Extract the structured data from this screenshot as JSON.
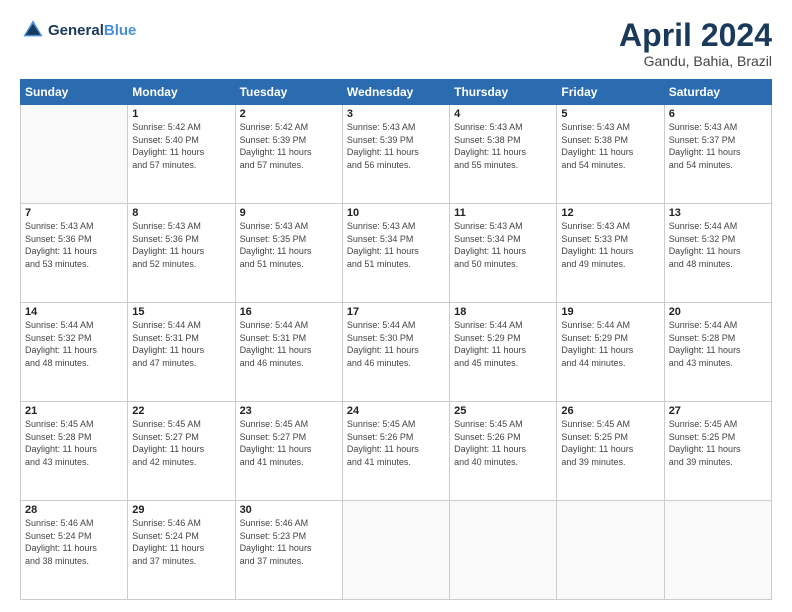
{
  "header": {
    "logo_line1": "General",
    "logo_line2": "Blue",
    "month": "April 2024",
    "location": "Gandu, Bahia, Brazil"
  },
  "weekdays": [
    "Sunday",
    "Monday",
    "Tuesday",
    "Wednesday",
    "Thursday",
    "Friday",
    "Saturday"
  ],
  "weeks": [
    [
      {
        "day": "",
        "info": ""
      },
      {
        "day": "1",
        "info": "Sunrise: 5:42 AM\nSunset: 5:40 PM\nDaylight: 11 hours\nand 57 minutes."
      },
      {
        "day": "2",
        "info": "Sunrise: 5:42 AM\nSunset: 5:39 PM\nDaylight: 11 hours\nand 57 minutes."
      },
      {
        "day": "3",
        "info": "Sunrise: 5:43 AM\nSunset: 5:39 PM\nDaylight: 11 hours\nand 56 minutes."
      },
      {
        "day": "4",
        "info": "Sunrise: 5:43 AM\nSunset: 5:38 PM\nDaylight: 11 hours\nand 55 minutes."
      },
      {
        "day": "5",
        "info": "Sunrise: 5:43 AM\nSunset: 5:38 PM\nDaylight: 11 hours\nand 54 minutes."
      },
      {
        "day": "6",
        "info": "Sunrise: 5:43 AM\nSunset: 5:37 PM\nDaylight: 11 hours\nand 54 minutes."
      }
    ],
    [
      {
        "day": "7",
        "info": "Sunrise: 5:43 AM\nSunset: 5:36 PM\nDaylight: 11 hours\nand 53 minutes."
      },
      {
        "day": "8",
        "info": "Sunrise: 5:43 AM\nSunset: 5:36 PM\nDaylight: 11 hours\nand 52 minutes."
      },
      {
        "day": "9",
        "info": "Sunrise: 5:43 AM\nSunset: 5:35 PM\nDaylight: 11 hours\nand 51 minutes."
      },
      {
        "day": "10",
        "info": "Sunrise: 5:43 AM\nSunset: 5:34 PM\nDaylight: 11 hours\nand 51 minutes."
      },
      {
        "day": "11",
        "info": "Sunrise: 5:43 AM\nSunset: 5:34 PM\nDaylight: 11 hours\nand 50 minutes."
      },
      {
        "day": "12",
        "info": "Sunrise: 5:43 AM\nSunset: 5:33 PM\nDaylight: 11 hours\nand 49 minutes."
      },
      {
        "day": "13",
        "info": "Sunrise: 5:44 AM\nSunset: 5:32 PM\nDaylight: 11 hours\nand 48 minutes."
      }
    ],
    [
      {
        "day": "14",
        "info": "Sunrise: 5:44 AM\nSunset: 5:32 PM\nDaylight: 11 hours\nand 48 minutes."
      },
      {
        "day": "15",
        "info": "Sunrise: 5:44 AM\nSunset: 5:31 PM\nDaylight: 11 hours\nand 47 minutes."
      },
      {
        "day": "16",
        "info": "Sunrise: 5:44 AM\nSunset: 5:31 PM\nDaylight: 11 hours\nand 46 minutes."
      },
      {
        "day": "17",
        "info": "Sunrise: 5:44 AM\nSunset: 5:30 PM\nDaylight: 11 hours\nand 46 minutes."
      },
      {
        "day": "18",
        "info": "Sunrise: 5:44 AM\nSunset: 5:29 PM\nDaylight: 11 hours\nand 45 minutes."
      },
      {
        "day": "19",
        "info": "Sunrise: 5:44 AM\nSunset: 5:29 PM\nDaylight: 11 hours\nand 44 minutes."
      },
      {
        "day": "20",
        "info": "Sunrise: 5:44 AM\nSunset: 5:28 PM\nDaylight: 11 hours\nand 43 minutes."
      }
    ],
    [
      {
        "day": "21",
        "info": "Sunrise: 5:45 AM\nSunset: 5:28 PM\nDaylight: 11 hours\nand 43 minutes."
      },
      {
        "day": "22",
        "info": "Sunrise: 5:45 AM\nSunset: 5:27 PM\nDaylight: 11 hours\nand 42 minutes."
      },
      {
        "day": "23",
        "info": "Sunrise: 5:45 AM\nSunset: 5:27 PM\nDaylight: 11 hours\nand 41 minutes."
      },
      {
        "day": "24",
        "info": "Sunrise: 5:45 AM\nSunset: 5:26 PM\nDaylight: 11 hours\nand 41 minutes."
      },
      {
        "day": "25",
        "info": "Sunrise: 5:45 AM\nSunset: 5:26 PM\nDaylight: 11 hours\nand 40 minutes."
      },
      {
        "day": "26",
        "info": "Sunrise: 5:45 AM\nSunset: 5:25 PM\nDaylight: 11 hours\nand 39 minutes."
      },
      {
        "day": "27",
        "info": "Sunrise: 5:45 AM\nSunset: 5:25 PM\nDaylight: 11 hours\nand 39 minutes."
      }
    ],
    [
      {
        "day": "28",
        "info": "Sunrise: 5:46 AM\nSunset: 5:24 PM\nDaylight: 11 hours\nand 38 minutes."
      },
      {
        "day": "29",
        "info": "Sunrise: 5:46 AM\nSunset: 5:24 PM\nDaylight: 11 hours\nand 37 minutes."
      },
      {
        "day": "30",
        "info": "Sunrise: 5:46 AM\nSunset: 5:23 PM\nDaylight: 11 hours\nand 37 minutes."
      },
      {
        "day": "",
        "info": ""
      },
      {
        "day": "",
        "info": ""
      },
      {
        "day": "",
        "info": ""
      },
      {
        "day": "",
        "info": ""
      }
    ]
  ]
}
